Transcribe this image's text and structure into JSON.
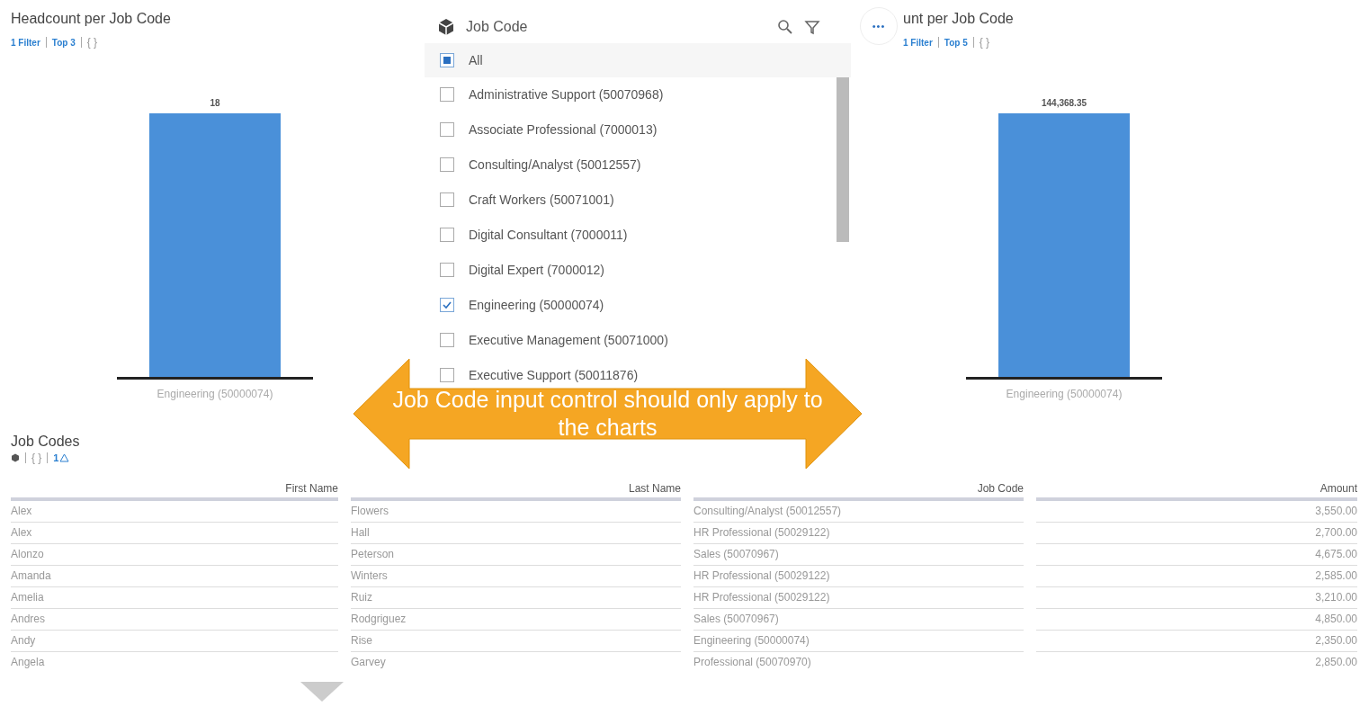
{
  "left_chart": {
    "title": "Headcount per Job Code",
    "links": [
      "1 Filter",
      "Top 3"
    ],
    "braces": "{ }",
    "bar_label": "18",
    "category": "Engineering (50000074)"
  },
  "dropdown": {
    "title": "Job Code",
    "items": [
      {
        "label": "All",
        "checked": false,
        "partial": true
      },
      {
        "label": "Administrative Support (50070968)",
        "checked": false,
        "partial": false
      },
      {
        "label": "Associate Professional (7000013)",
        "checked": false,
        "partial": false
      },
      {
        "label": "Consulting/Analyst (50012557)",
        "checked": false,
        "partial": false
      },
      {
        "label": "Craft Workers (50071001)",
        "checked": false,
        "partial": false
      },
      {
        "label": "Digital Consultant (7000011)",
        "checked": false,
        "partial": false
      },
      {
        "label": "Digital Expert (7000012)",
        "checked": false,
        "partial": false
      },
      {
        "label": "Engineering (50000074)",
        "checked": true,
        "partial": false
      },
      {
        "label": "Executive Management (50071000)",
        "checked": false,
        "partial": false
      },
      {
        "label": "Executive Support (50011876)",
        "checked": false,
        "partial": false
      }
    ],
    "more": "•••"
  },
  "right_chart": {
    "title": "unt per Job Code",
    "links": [
      "1 Filter",
      "Top 5"
    ],
    "braces": "{ }",
    "bar_label": "144,368.35",
    "category": "Engineering (50000074)"
  },
  "annotation": {
    "text": "Job Code input control should only apply to the charts"
  },
  "table": {
    "title": "Job Codes",
    "toolbar": {
      "braces": "{ }",
      "warning_count": "1"
    },
    "columns": [
      "First Name",
      "Last Name",
      "Job Code",
      "Amount"
    ],
    "rows": [
      [
        "Alex",
        "Flowers",
        "Consulting/Analyst (50012557)",
        "3,550.00"
      ],
      [
        "Alex",
        "Hall",
        "HR Professional (50029122)",
        "2,700.00"
      ],
      [
        "Alonzo",
        "Peterson",
        "Sales (50070967)",
        "4,675.00"
      ],
      [
        "Amanda",
        "Winters",
        "HR Professional (50029122)",
        "2,585.00"
      ],
      [
        "Amelia",
        "Ruiz",
        "HR Professional (50029122)",
        "3,210.00"
      ],
      [
        "Andres",
        "Rodgriguez",
        "Sales (50070967)",
        "4,850.00"
      ],
      [
        "Andy",
        "Rise",
        "Engineering (50000074)",
        "2,350.00"
      ],
      [
        "Angela",
        "Garvey",
        "Professional (50070970)",
        "2,850.00"
      ]
    ]
  }
}
